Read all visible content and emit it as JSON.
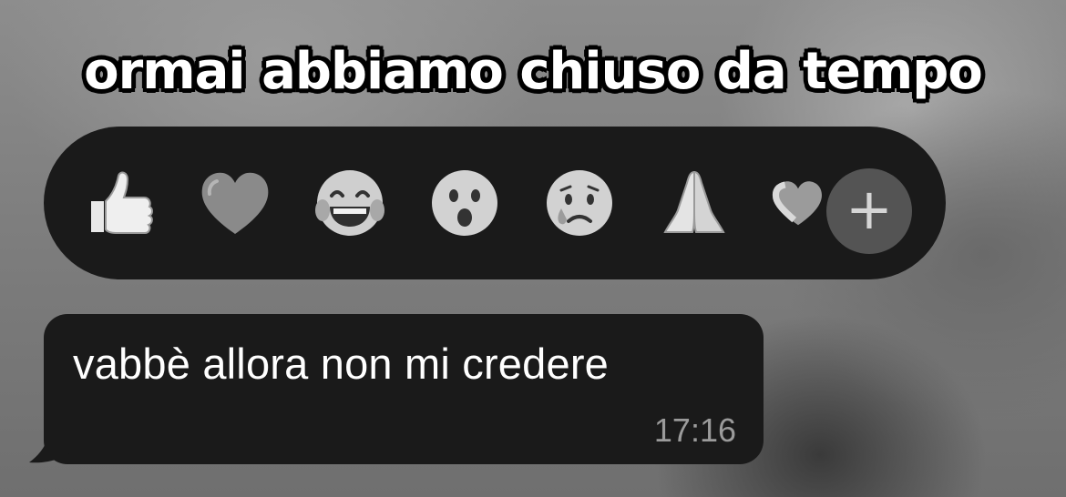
{
  "caption": {
    "text": "ormai abbiamo chiuso da tempo"
  },
  "reactions": {
    "items": [
      {
        "name": "thumbs-up",
        "glyph": "👍"
      },
      {
        "name": "heart",
        "glyph": "♥"
      },
      {
        "name": "tears-of-joy",
        "glyph": "😂"
      },
      {
        "name": "surprised-face",
        "glyph": "😮"
      },
      {
        "name": "crying-face",
        "glyph": "😢"
      },
      {
        "name": "folded-hands",
        "glyph": "🙏"
      },
      {
        "name": "heart-partial",
        "glyph": "♥"
      }
    ],
    "more_label": "+"
  },
  "message": {
    "text": "vabbè allora non mi credere",
    "time": "17:16"
  }
}
